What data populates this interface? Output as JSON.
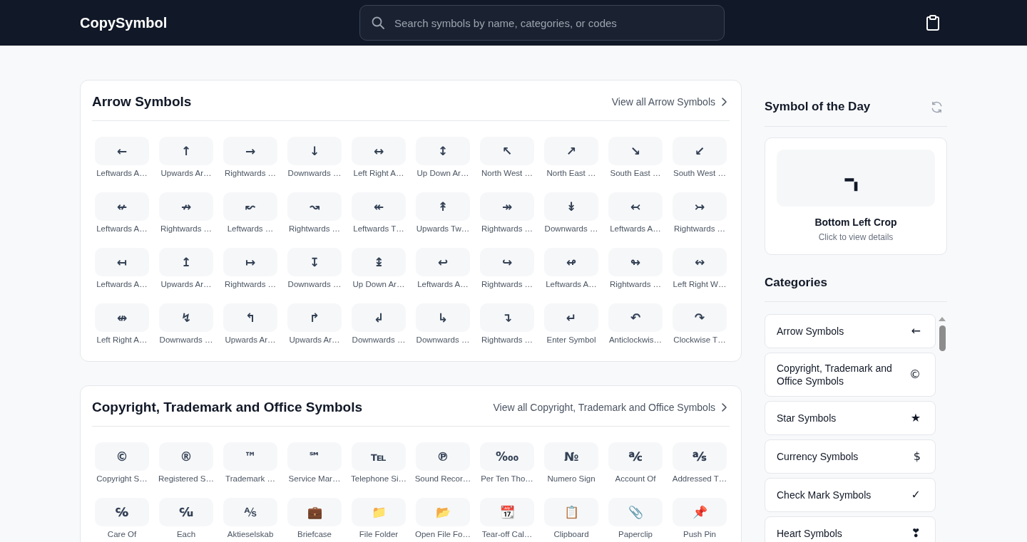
{
  "header": {
    "logo": "CopySymbol",
    "search": {
      "placeholder": "Search symbols by name, categories, or codes"
    }
  },
  "sections": [
    {
      "title": "Arrow Symbols",
      "view_all": "View all Arrow Symbols",
      "symbols": [
        {
          "glyph": "←",
          "name": "Leftwards A…"
        },
        {
          "glyph": "↑",
          "name": "Upwards Ar…"
        },
        {
          "glyph": "→",
          "name": "Rightwards …"
        },
        {
          "glyph": "↓",
          "name": "Downwards …"
        },
        {
          "glyph": "↔",
          "name": "Left Right A…"
        },
        {
          "glyph": "↕",
          "name": "Up Down Ar…"
        },
        {
          "glyph": "↖",
          "name": "North West …"
        },
        {
          "glyph": "↗",
          "name": "North East …"
        },
        {
          "glyph": "↘",
          "name": "South East …"
        },
        {
          "glyph": "↙",
          "name": "South West …"
        },
        {
          "glyph": "↚",
          "name": "Leftwards A…"
        },
        {
          "glyph": "↛",
          "name": "Rightwards …"
        },
        {
          "glyph": "↜",
          "name": "Leftwards …"
        },
        {
          "glyph": "↝",
          "name": "Rightwards …"
        },
        {
          "glyph": "↞",
          "name": "Leftwards T…"
        },
        {
          "glyph": "↟",
          "name": "Upwards Tw…"
        },
        {
          "glyph": "↠",
          "name": "Rightwards …"
        },
        {
          "glyph": "↡",
          "name": "Downwards …"
        },
        {
          "glyph": "↢",
          "name": "Leftwards A…"
        },
        {
          "glyph": "↣",
          "name": "Rightwards …"
        },
        {
          "glyph": "↤",
          "name": "Leftwards A…"
        },
        {
          "glyph": "↥",
          "name": "Upwards Ar…"
        },
        {
          "glyph": "↦",
          "name": "Rightwards …"
        },
        {
          "glyph": "↧",
          "name": "Downwards …"
        },
        {
          "glyph": "↨",
          "name": "Up Down Ar…"
        },
        {
          "glyph": "↩",
          "name": "Leftwards A…"
        },
        {
          "glyph": "↪",
          "name": "Rightwards …"
        },
        {
          "glyph": "↫",
          "name": "Leftwards A…"
        },
        {
          "glyph": "↬",
          "name": "Rightwards …"
        },
        {
          "glyph": "↭",
          "name": "Left Right W…"
        },
        {
          "glyph": "↮",
          "name": "Left Right A…"
        },
        {
          "glyph": "↯",
          "name": "Downwards …"
        },
        {
          "glyph": "↰",
          "name": "Upwards Ar…"
        },
        {
          "glyph": "↱",
          "name": "Upwards Ar…"
        },
        {
          "glyph": "↲",
          "name": "Downwards …"
        },
        {
          "glyph": "↳",
          "name": "Downwards …"
        },
        {
          "glyph": "↴",
          "name": "Rightwards …"
        },
        {
          "glyph": "↵",
          "name": "Enter Symbol"
        },
        {
          "glyph": "↶",
          "name": "Anticlockwis…"
        },
        {
          "glyph": "↷",
          "name": "Clockwise T…"
        }
      ]
    },
    {
      "title": "Copyright, Trademark and Office Symbols",
      "view_all": "View all Copyright, Trademark and Office Symbols",
      "symbols": [
        {
          "glyph": "©",
          "name": "Copyright S…"
        },
        {
          "glyph": "®",
          "name": "Registered S…"
        },
        {
          "glyph": "™",
          "name": "Trademark …"
        },
        {
          "glyph": "℠",
          "name": "Service Mar…"
        },
        {
          "glyph": "℡",
          "name": "Telephone Si…"
        },
        {
          "glyph": "℗",
          "name": "Sound Recor…"
        },
        {
          "glyph": "‱",
          "name": "Per Ten Tho…"
        },
        {
          "glyph": "№",
          "name": "Numero Sign"
        },
        {
          "glyph": "℀",
          "name": "Account Of"
        },
        {
          "glyph": "℁",
          "name": "Addressed T…"
        },
        {
          "glyph": "℅",
          "name": "Care Of"
        },
        {
          "glyph": "℆",
          "name": "Each"
        },
        {
          "glyph": "⅍",
          "name": "Aktieselskab"
        },
        {
          "glyph": "💼",
          "name": "Briefcase"
        },
        {
          "glyph": "📁",
          "name": "File Folder"
        },
        {
          "glyph": "📂",
          "name": "Open File Fo…"
        },
        {
          "glyph": "📆",
          "name": "Tear-off Cal…"
        },
        {
          "glyph": "📋",
          "name": "Clipboard"
        },
        {
          "glyph": "📎",
          "name": "Paperclip"
        },
        {
          "glyph": "📌",
          "name": "Push Pin"
        }
      ]
    }
  ],
  "symbol_of_the_day": {
    "title": "Symbol of the Day",
    "glyph": "⌍",
    "name": "Bottom Left Crop",
    "hint": "Click to view details"
  },
  "categories": {
    "title": "Categories",
    "items": [
      {
        "name": "Arrow Symbols",
        "glyph": "←"
      },
      {
        "name": "Copyright, Trademark and Office Symbols",
        "glyph": "©"
      },
      {
        "name": "Star Symbols",
        "glyph": "★"
      },
      {
        "name": "Currency Symbols",
        "glyph": "$"
      },
      {
        "name": "Check Mark Symbols",
        "glyph": "✓"
      },
      {
        "name": "Heart Symbols",
        "glyph": "❣"
      }
    ]
  }
}
